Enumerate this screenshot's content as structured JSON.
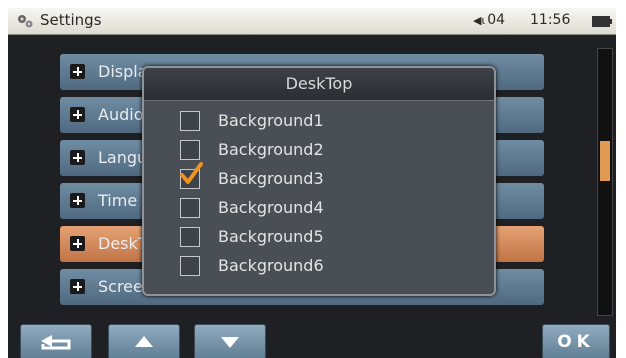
{
  "status_bar": {
    "title": "Settings",
    "volume": "04",
    "time": "11:56",
    "icons": [
      "settings-icon",
      "speaker-icon",
      "battery-icon"
    ]
  },
  "menu": {
    "items": [
      {
        "label": "Display"
      },
      {
        "label": "Audio"
      },
      {
        "label": "Language"
      },
      {
        "label": "Time"
      },
      {
        "label": "DeskTop",
        "selected": true
      },
      {
        "label": "Screen Touch Set"
      }
    ]
  },
  "popup": {
    "title": "DeskTop",
    "options": [
      {
        "label": "Background1",
        "checked": false
      },
      {
        "label": "Background2",
        "checked": false
      },
      {
        "label": "Background3",
        "checked": true
      },
      {
        "label": "Background4",
        "checked": false
      },
      {
        "label": "Background5",
        "checked": false
      },
      {
        "label": "Background6",
        "checked": false
      }
    ]
  },
  "toolbar": {
    "back_icon": "back-icon",
    "up_icon": "arrow-up-icon",
    "down_icon": "arrow-down-icon",
    "ok_label": "OK"
  },
  "colors": {
    "accent": "#e09a54",
    "selected_item": "#d08858",
    "menu_item": "#5f7b91"
  }
}
